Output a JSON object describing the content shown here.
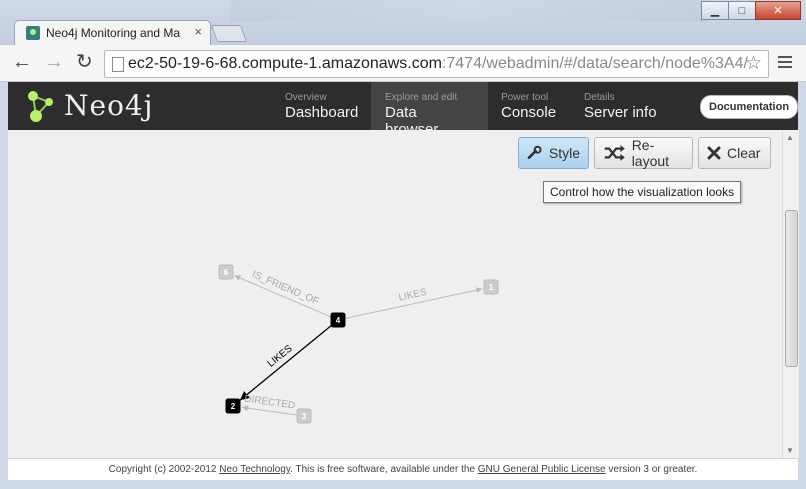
{
  "browser": {
    "tab_title": "Neo4j Monitoring and Ma",
    "tab_close": "×",
    "url_host": "ec2-50-19-6-68.compute-1.amazonaws.com",
    "url_rest": ":7474/webadmin/#/data/search/node%3A4/",
    "back": "←",
    "forward": "→",
    "reload": "↻",
    "star": "☆",
    "win_min": "▁",
    "win_max": "□",
    "win_close": "✕"
  },
  "app": {
    "logo": "Neo4j",
    "nav": [
      {
        "sub": "Overview",
        "label": "Dashboard"
      },
      {
        "sub": "Explore and edit",
        "label": "Data browser"
      },
      {
        "sub": "Power tool",
        "label": "Console"
      },
      {
        "sub": "Details",
        "label": "Server info"
      }
    ],
    "documentation": "Documentation"
  },
  "toolbar": {
    "style": "Style",
    "relayout": "Re-layout",
    "clear": "Clear",
    "tooltip": "Control how the visualization looks"
  },
  "graph": {
    "nodes": [
      {
        "id": "4",
        "state": "active"
      },
      {
        "id": "6",
        "state": "faded"
      },
      {
        "id": "1",
        "state": "faded"
      },
      {
        "id": "2",
        "state": "active"
      },
      {
        "id": "3",
        "state": "faded"
      }
    ],
    "edges": [
      {
        "from": "4",
        "to": "6",
        "label": "IS_FRIEND_OF",
        "state": "faded"
      },
      {
        "from": "4",
        "to": "1",
        "label": "LIKES",
        "state": "faded"
      },
      {
        "from": "4",
        "to": "2",
        "label": "LIKES",
        "state": "active"
      },
      {
        "from": "3",
        "to": "2",
        "label": "DIRECTED",
        "state": "faded"
      }
    ]
  },
  "footer": {
    "prefix": "Copyright (c) 2002-2012 ",
    "company": "Neo Technology",
    "middle": ". This is free software, available under the ",
    "license": "GNU General Public License",
    "suffix": " version 3 or greater."
  }
}
